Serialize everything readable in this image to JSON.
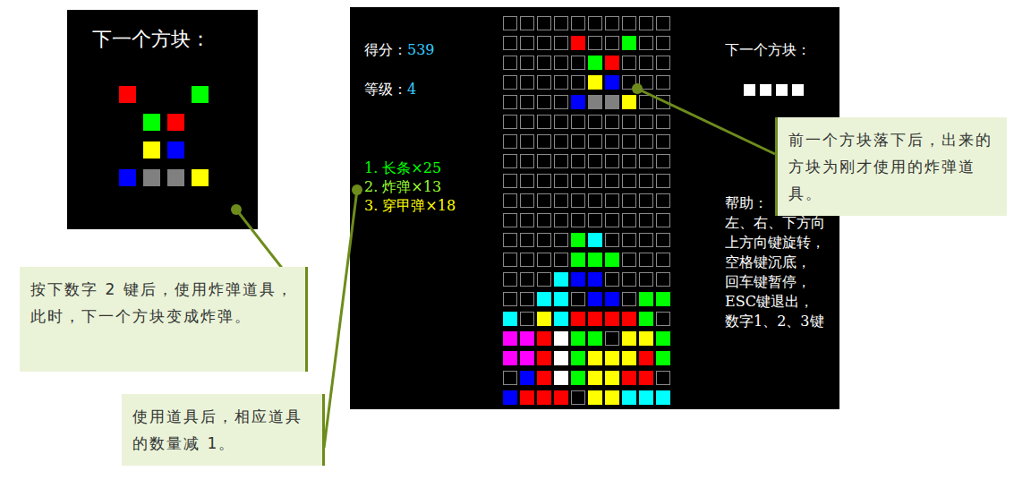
{
  "guide_panel": {
    "title": "下一个方块：",
    "preview": [
      [
        "#ff0000",
        "",
        "",
        "#00ff00"
      ],
      [
        "",
        "#00ff00",
        "#ff0000",
        ""
      ],
      [
        "",
        "#ffff00",
        "#0000ff",
        ""
      ],
      [
        "#0000ff",
        "#808080",
        "#808080",
        "#ffff00"
      ]
    ]
  },
  "game": {
    "score_label": "得分：",
    "score": "539",
    "level_label": "等级：",
    "level": "4",
    "items": [
      {
        "label": "1. 长条×25",
        "color": "#00ff00"
      },
      {
        "label": "2. 炸弹×13",
        "color": "#99ff33"
      },
      {
        "label": "3. 穿甲弹×18",
        "color": "#ffff00"
      }
    ],
    "board": [
      [
        "",
        "",
        "",
        "",
        "",
        "",
        "",
        "",
        "",
        ""
      ],
      [
        "",
        "",
        "",
        "",
        "#ff0000",
        "",
        "",
        "#00ff00",
        "",
        ""
      ],
      [
        "",
        "",
        "",
        "",
        "",
        "#00ff00",
        "#ff0000",
        "",
        "",
        ""
      ],
      [
        "",
        "",
        "",
        "",
        "",
        "#ffff00",
        "#0000ff",
        "",
        "",
        ""
      ],
      [
        "",
        "",
        "",
        "",
        "#0000ff",
        "#808080",
        "#808080",
        "#ffff00",
        "",
        ""
      ],
      [
        "",
        "",
        "",
        "",
        "",
        "",
        "",
        "",
        "",
        ""
      ],
      [
        "",
        "",
        "",
        "",
        "",
        "",
        "",
        "",
        "",
        ""
      ],
      [
        "",
        "",
        "",
        "",
        "",
        "",
        "",
        "",
        "",
        ""
      ],
      [
        "",
        "",
        "",
        "",
        "",
        "",
        "",
        "",
        "",
        ""
      ],
      [
        "",
        "",
        "",
        "",
        "",
        "",
        "",
        "",
        "",
        ""
      ],
      [
        "",
        "",
        "",
        "",
        "",
        "",
        "",
        "",
        "",
        ""
      ],
      [
        "",
        "",
        "",
        "",
        "#00ff00",
        "#00ffff",
        "",
        "",
        "",
        ""
      ],
      [
        "",
        "",
        "",
        "",
        "#00ff00",
        "#00ff00",
        "#00ff00",
        "",
        "",
        ""
      ],
      [
        "",
        "",
        "",
        "#00ffff",
        "#0000ff",
        "#0000ff",
        "",
        "",
        "",
        ""
      ],
      [
        "",
        "",
        "#00ffff",
        "#00ffff",
        "",
        "#0000ff",
        "#0000ff",
        "",
        "#00ff00",
        "#00ff00"
      ],
      [
        "#00ffff",
        "",
        "#ffff00",
        "#00ffff",
        "#ff0000",
        "#ff0000",
        "#ff0000",
        "#ff0000",
        "#00ff00",
        ""
      ],
      [
        "#ff00ff",
        "#ff00ff",
        "#ff0000",
        "#ffffff",
        "#00ff00",
        "#00ff00",
        "",
        "#ffff00",
        "#ffff00",
        "#00ff00"
      ],
      [
        "#ff00ff",
        "#ff00ff",
        "#ff0000",
        "#ffffff",
        "#00ff00",
        "#ffff00",
        "#ffff00",
        "#ffff00",
        "#ff0000",
        "#00ff00"
      ],
      [
        "",
        "#0000ff",
        "#ff0000",
        "#ffffff",
        "#00ff00",
        "#ffff00",
        "#ffff00",
        "#ff0000",
        "#ff0000",
        ""
      ],
      [
        "#0000ff",
        "#ff0000",
        "#ff0000",
        "#ff0000",
        "",
        "#ffff00",
        "#ffff00",
        "#00ffff",
        "#00ffff",
        "#00ffff"
      ]
    ],
    "next_title": "下一个方块：",
    "next": [
      "#ffffff",
      "#ffffff",
      "#ffffff",
      "#ffffff"
    ],
    "help_title": "帮助：",
    "help_lines": [
      "左、右、下方向",
      "上方向键旋转，",
      "空格键沉底，",
      "回车键暂停，",
      "ESC键退出，",
      "数字1、2、3键"
    ]
  },
  "callouts": [
    {
      "text": "按下数字 2 键后，使用炸弹道具，此时，下一个方块变成炸弹。"
    },
    {
      "text": "使用道具后，相应道具的数量减 1。"
    },
    {
      "text": "前一个方块落下后，出来的方块为刚才使用的炸弹道具。"
    }
  ]
}
